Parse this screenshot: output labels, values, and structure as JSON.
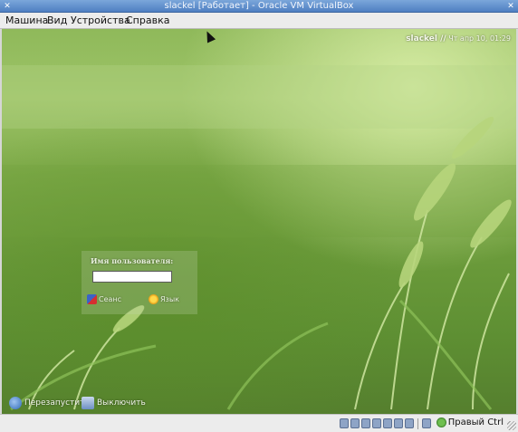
{
  "window": {
    "title": "slackel [Работает] - Oracle VM VirtualBox",
    "close_glyph": "✕"
  },
  "menubar": {
    "items": [
      "Машина",
      "Вид",
      "Устройства",
      "Справка"
    ]
  },
  "guest": {
    "clock": {
      "host": "slackel //",
      "datetime": "Чт апр 10, 01:29"
    },
    "login": {
      "username_label": "Имя пользователя:",
      "username_value": "",
      "session_label": "Сеанс",
      "language_label": "Язык"
    },
    "bottom": {
      "restart_label": "Перезапустить",
      "shutdown_label": "Выключить"
    }
  },
  "statusbar": {
    "icons": [
      "hard-disk-icon",
      "optical-drive-icon",
      "usb-icon",
      "network-icon",
      "shared-folders-icon",
      "display-icon",
      "video-capture-icon",
      "mouse-integration-icon"
    ],
    "host_key_label": "Правый Ctrl"
  }
}
